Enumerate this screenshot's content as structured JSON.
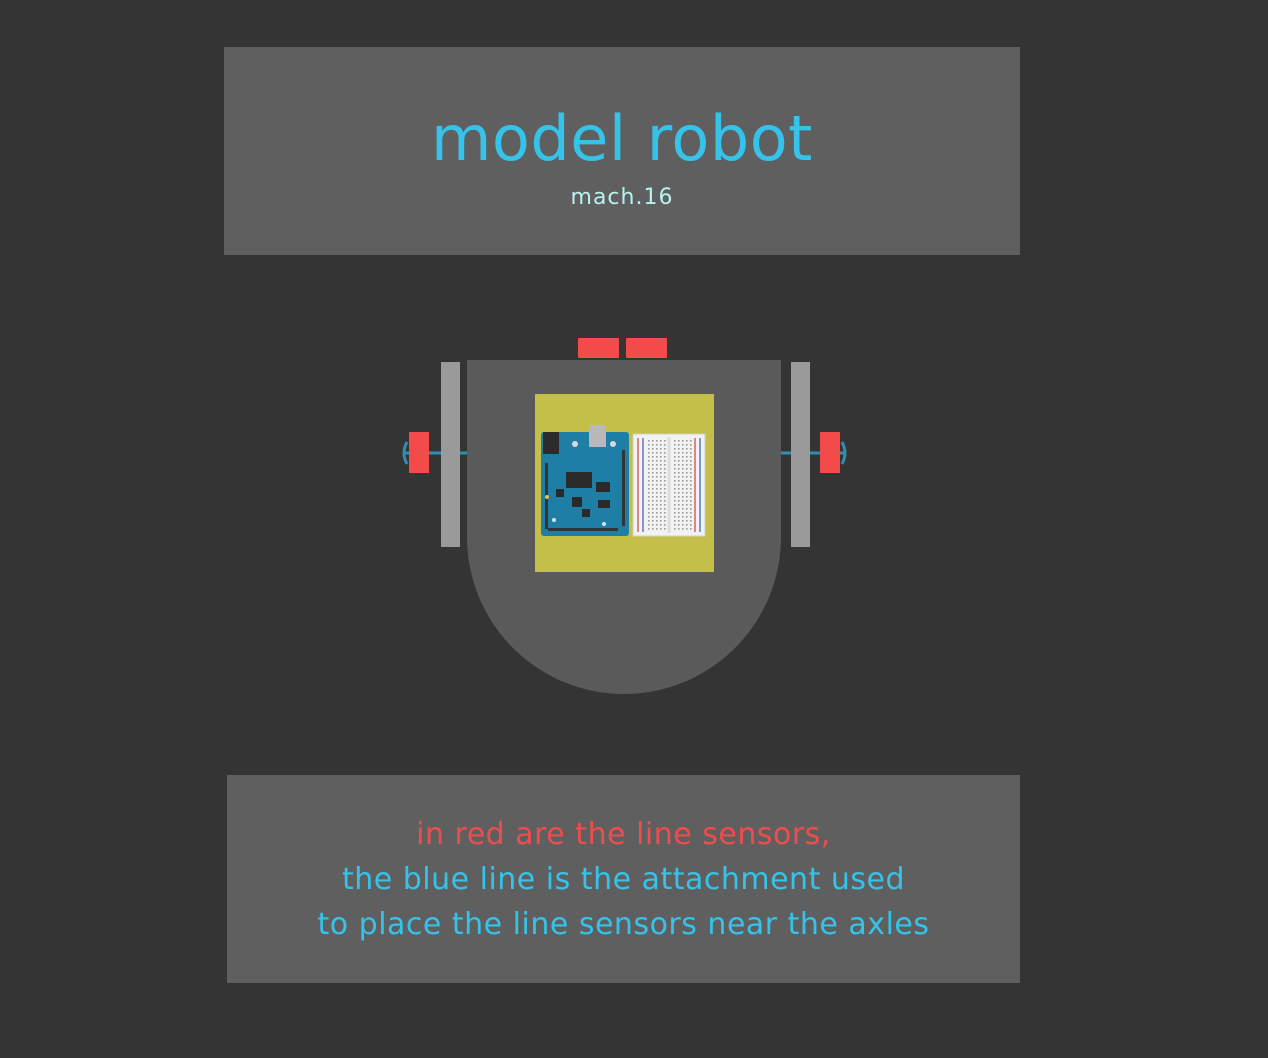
{
  "header": {
    "title": "model robot",
    "subtitle": "mach.16"
  },
  "caption": {
    "line_red": "in red are the line sensors,",
    "line_blue_1": "the blue line is the attachment used",
    "line_blue_2": "to place the line sensors near the axles"
  },
  "colors": {
    "background": "#343434",
    "panel": "#5f5f5f",
    "robot_body": "#5a5a5a",
    "wheel": "#9a9a9a",
    "sensor_red": "#f34a4a",
    "attachment_blue": "#2f8fb0",
    "mount_plate": "#c4bf48",
    "arduino_board": "#1f7ea6",
    "title_blue": "#35c3ea",
    "subtitle_mint": "#b8f2ec",
    "caption_red": "#ee4d4d"
  },
  "icons": {
    "arduino": "arduino-board-icon",
    "breadboard": "breadboard-icon"
  }
}
